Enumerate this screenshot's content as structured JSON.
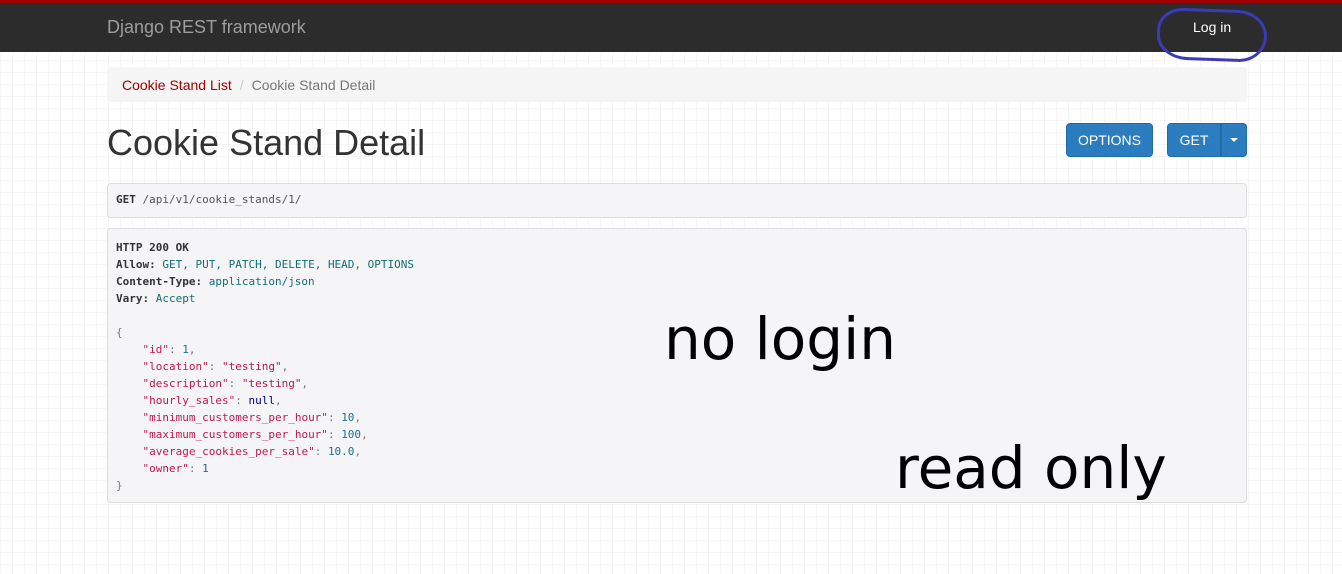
{
  "navbar": {
    "brand": "Django REST framework",
    "login": "Log in"
  },
  "breadcrumb": {
    "items": [
      "Cookie Stand List",
      "Cookie Stand Detail"
    ]
  },
  "page": {
    "title": "Cookie Stand Detail"
  },
  "buttons": {
    "options": "OPTIONS",
    "get": "GET"
  },
  "request": {
    "method": "GET",
    "path": "/api/v1/cookie_stands/1/"
  },
  "response": {
    "status": "HTTP 200 OK",
    "headers": [
      {
        "name": "Allow:",
        "value": "GET, PUT, PATCH, DELETE, HEAD, OPTIONS"
      },
      {
        "name": "Content-Type:",
        "value": "application/json"
      },
      {
        "name": "Vary:",
        "value": "Accept"
      }
    ],
    "body": [
      {
        "key": "\"id\"",
        "value": "1",
        "type": "num"
      },
      {
        "key": "\"location\"",
        "value": "\"testing\"",
        "type": "str"
      },
      {
        "key": "\"description\"",
        "value": "\"testing\"",
        "type": "str"
      },
      {
        "key": "\"hourly_sales\"",
        "value": "null",
        "type": "nul"
      },
      {
        "key": "\"minimum_customers_per_hour\"",
        "value": "10",
        "type": "num"
      },
      {
        "key": "\"maximum_customers_per_hour\"",
        "value": "100",
        "type": "num"
      },
      {
        "key": "\"average_cookies_per_sale\"",
        "value": "10.0",
        "type": "num"
      },
      {
        "key": "\"owner\"",
        "value": "1",
        "type": "num"
      }
    ]
  },
  "annotations": {
    "note1": "no login",
    "note2": "read only"
  },
  "colors": {
    "navbar_bg": "#2c2c2c",
    "accent_red": "#a30000",
    "button_blue": "#2c7dbf",
    "annotation_circle": "#3b3bb8"
  }
}
